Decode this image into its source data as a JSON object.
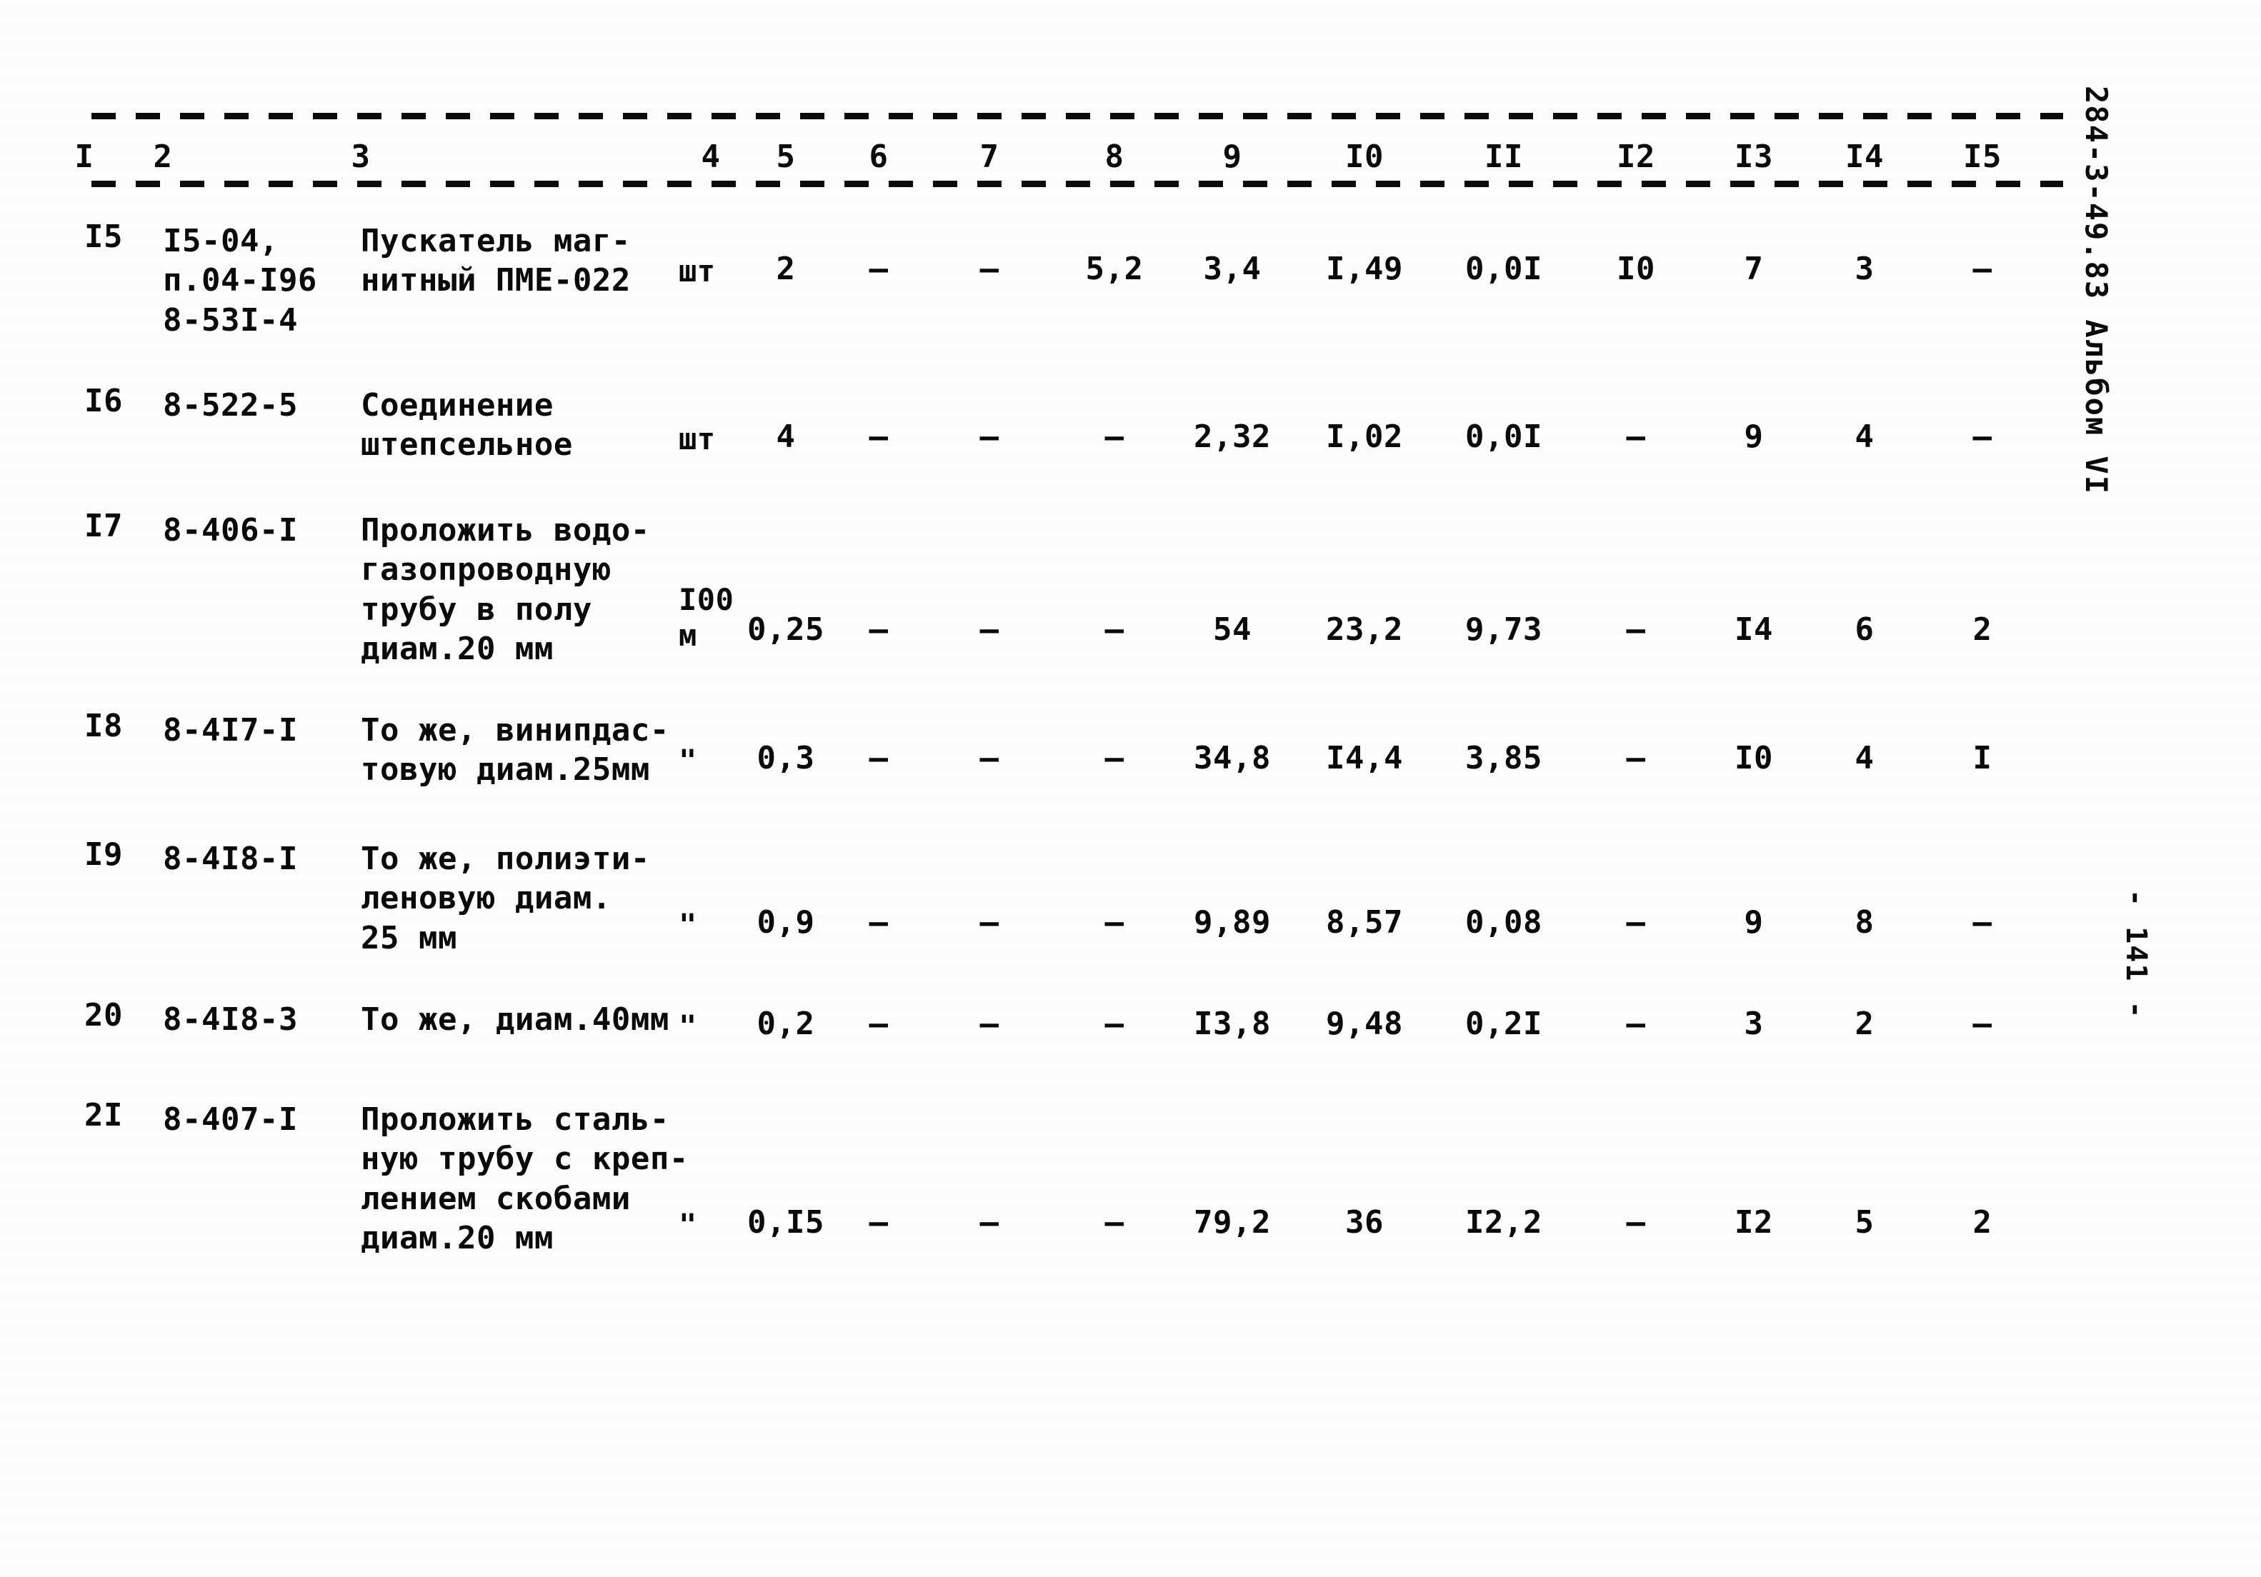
{
  "document": {
    "margin_stamp": "284-3-49.83 Альбом VI",
    "page_number": "- 141 -"
  },
  "table": {
    "column_headers": [
      "I",
      "2",
      "3",
      "4",
      "5",
      "6",
      "7",
      "8",
      "9",
      "I0",
      "II",
      "I2",
      "I3",
      "I4",
      "I5"
    ],
    "rows": [
      {
        "num": "I5",
        "code": [
          "I5-04,",
          "п.04-I96",
          "8-53I-4"
        ],
        "description": [
          "Пускатель маг-",
          "нитный ПМЕ-022"
        ],
        "unit": [
          "шт"
        ],
        "values": [
          "2",
          "–",
          "–",
          "5,2",
          "3,4",
          "I,49",
          "0,0I",
          "I0",
          "7",
          "3",
          "–"
        ]
      },
      {
        "num": "I6",
        "code": [
          "8-522-5"
        ],
        "description": [
          "Соединение",
          "штепсельное"
        ],
        "unit": [
          "шт"
        ],
        "values": [
          "4",
          "–",
          "–",
          "–",
          "2,32",
          "I,02",
          "0,0I",
          "–",
          "9",
          "4",
          "–"
        ]
      },
      {
        "num": "I7",
        "code": [
          "8-406-I"
        ],
        "description": [
          "Проложить водо-",
          "газопроводную",
          "трубу в полу",
          "диам.20 мм"
        ],
        "unit": [
          "I00",
          "м"
        ],
        "values": [
          "0,25",
          "–",
          "–",
          "–",
          "54",
          "23,2",
          "9,73",
          "–",
          "I4",
          "6",
          "2"
        ]
      },
      {
        "num": "I8",
        "code": [
          "8-4I7-I"
        ],
        "description": [
          "То же, винипдас-",
          "товую диам.25мм"
        ],
        "unit": [
          "\""
        ],
        "values": [
          "0,3",
          "–",
          "–",
          "–",
          "34,8",
          "I4,4",
          "3,85",
          "–",
          "I0",
          "4",
          "I"
        ]
      },
      {
        "num": "I9",
        "code": [
          "8-4I8-I"
        ],
        "description": [
          "То же, полиэти-",
          "леновую диам.",
          "25 мм"
        ],
        "unit": [
          "\""
        ],
        "values": [
          "0,9",
          "–",
          "–",
          "–",
          "9,89",
          "8,57",
          "0,08",
          "–",
          "9",
          "8",
          "–"
        ]
      },
      {
        "num": "20",
        "code": [
          "8-4I8-3"
        ],
        "description": [
          "То же, диам.40мм"
        ],
        "unit": [
          "\""
        ],
        "values": [
          "0,2",
          "–",
          "–",
          "–",
          "I3,8",
          "9,48",
          "0,2I",
          "–",
          "3",
          "2",
          "–"
        ]
      },
      {
        "num": "2I",
        "code": [
          "8-407-I"
        ],
        "description": [
          "Проложить сталь-",
          "ную трубу с креп-",
          "лением скобами",
          "диам.20 мм"
        ],
        "unit": [
          "\""
        ],
        "values": [
          "0,I5",
          "–",
          "–",
          "–",
          "79,2",
          "36",
          "I2,2",
          "–",
          "I2",
          "5",
          "2"
        ]
      }
    ]
  },
  "layout": {
    "header_x": [
      118,
      228,
      505,
      995,
      1100,
      1230,
      1385,
      1560,
      1725,
      1910,
      2105,
      2290,
      2455,
      2610,
      2775
    ],
    "value_x": [
      1100,
      1230,
      1385,
      1560,
      1725,
      1910,
      2105,
      2290,
      2455,
      2610,
      2775
    ],
    "row_tops": [
      310,
      540,
      715,
      995,
      1175,
      1400,
      1540
    ],
    "row_value_tops": [
      355,
      590,
      860,
      1040,
      1270,
      1412,
      1690
    ],
    "unit_tops": [
      355,
      590,
      815,
      1040,
      1270,
      1412,
      1690
    ]
  }
}
